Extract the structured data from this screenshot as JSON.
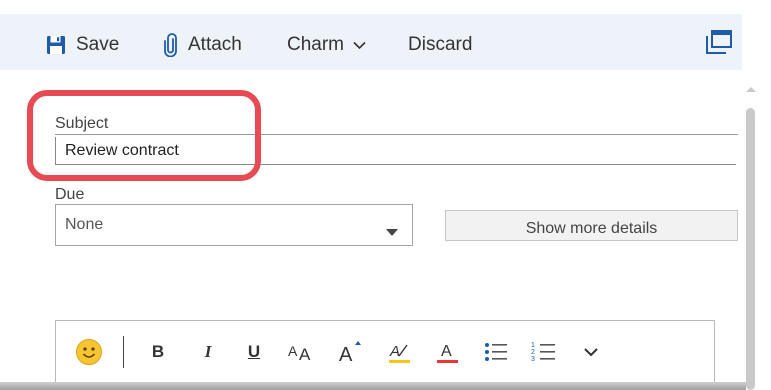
{
  "toolbar": {
    "save_label": "Save",
    "attach_label": "Attach",
    "charm_label": "Charm",
    "discard_label": "Discard"
  },
  "form": {
    "subject_label": "Subject",
    "subject_value": "Review contract",
    "due_label": "Due",
    "due_value": "None",
    "more_details_label": "Show more details"
  },
  "format_toolbar": {
    "bold": "B",
    "italic": "I",
    "underline": "U"
  },
  "colors": {
    "accent": "#1e5ba8",
    "highlight": "#e64a52",
    "toolbar_bg": "#eef3f9",
    "font_color_underline": "#e53935",
    "highlight_color_underline": "#f5c518"
  },
  "icons": [
    "save-icon",
    "paperclip-icon",
    "chevron-down-icon",
    "popout-icon",
    "emoji-icon",
    "font-size-icon",
    "grow-font-icon",
    "highlight-icon",
    "font-color-icon",
    "bullets-icon",
    "numbering-icon"
  ]
}
